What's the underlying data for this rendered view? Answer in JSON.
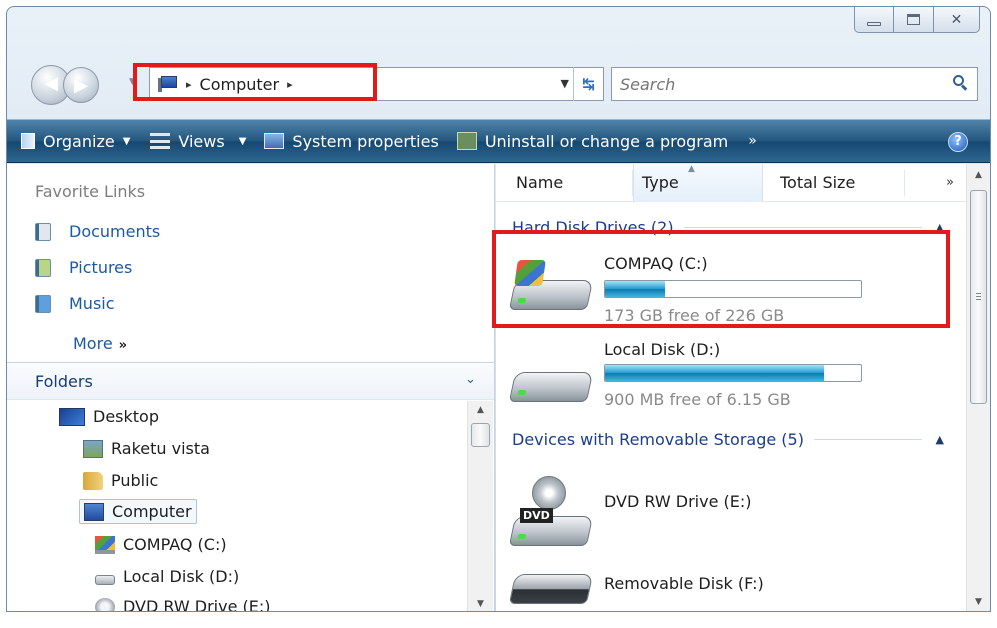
{
  "window": {
    "caption": {
      "minimize": "minimize-icon",
      "maximize": "maximize-icon",
      "close": "✕"
    }
  },
  "nav": {
    "address": {
      "root_sep": "▸",
      "location": "Computer",
      "trail_sep": "▸"
    },
    "search": {
      "placeholder": "Search"
    }
  },
  "commands": {
    "organize": "Organize",
    "views": "Views",
    "system_properties": "System properties",
    "uninstall": "Uninstall or change a program",
    "more": "»",
    "help": "?"
  },
  "sidebar": {
    "favorites_title": "Favorite Links",
    "favorites": [
      {
        "label": "Documents",
        "icon": "documents-icon"
      },
      {
        "label": "Pictures",
        "icon": "pictures-icon"
      },
      {
        "label": "Music",
        "icon": "music-icon"
      }
    ],
    "more_label": "More",
    "more_glyph": "»",
    "folders_title": "Folders",
    "folders_chevron": "⌄",
    "tree": [
      {
        "label": "Desktop",
        "icon": "desktop-icon"
      },
      {
        "label": "Raketu vista",
        "icon": "user-folder-icon"
      },
      {
        "label": "Public",
        "icon": "public-folder-icon"
      },
      {
        "label": "Computer",
        "icon": "computer-icon"
      },
      {
        "label": "COMPAQ (C:)",
        "icon": "hard-drive-c-icon"
      },
      {
        "label": "Local Disk (D:)",
        "icon": "hard-drive-d-icon"
      },
      {
        "label": "DVD RW Drive (E:)",
        "icon": "dvd-drive-icon"
      }
    ]
  },
  "content": {
    "columns": [
      "Name",
      "Type",
      "Total Size"
    ],
    "columns_more": "»",
    "groups": {
      "hard_disks": {
        "title": "Hard Disk Drives (2)"
      },
      "removable": {
        "title": "Devices with Removable Storage (5)"
      }
    },
    "drives": [
      {
        "name": "COMPAQ (C:)",
        "free_text": "173 GB free of 226 GB",
        "used_fraction": 0.234
      },
      {
        "name": "Local Disk (D:)",
        "free_text": "900 MB free of 6.15 GB",
        "used_fraction": 0.857
      },
      {
        "name": "DVD RW Drive (E:)",
        "badge": "DVD"
      },
      {
        "name": "Removable Disk (F:)"
      }
    ]
  },
  "colors": {
    "accent_red": "#e11b1b",
    "link_blue": "#1b5aa4",
    "bar_blue": "#1f9bd1"
  }
}
